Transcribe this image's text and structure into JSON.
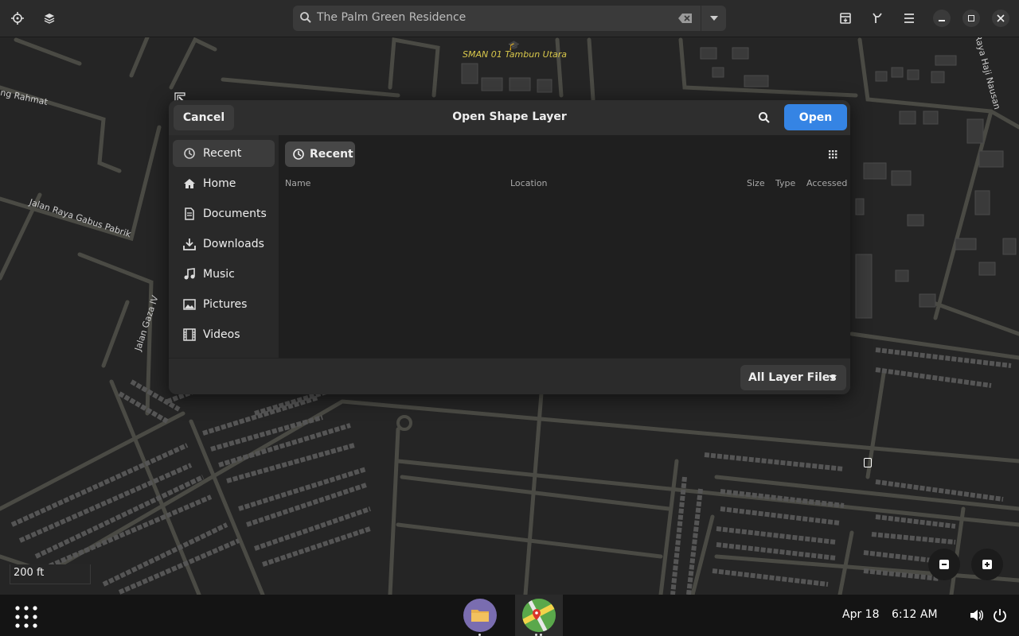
{
  "window": {
    "search_value": "The Palm Green Residence"
  },
  "map": {
    "labels": [
      "ng Rahmat",
      "Jalan Raya Gabus Pabrik",
      "Jalan Gaza IV",
      "Raya Haji Nausan"
    ],
    "poi": "SMAN 01 Tambun Utara",
    "scale": "200 ft"
  },
  "dialog": {
    "title": "Open Shape Layer",
    "cancel_label": "Cancel",
    "open_label": "Open",
    "sidebar": [
      {
        "label": "Recent",
        "icon": "clock-icon",
        "active": true
      },
      {
        "label": "Home",
        "icon": "home-icon"
      },
      {
        "label": "Documents",
        "icon": "document-icon"
      },
      {
        "label": "Downloads",
        "icon": "download-icon"
      },
      {
        "label": "Music",
        "icon": "music-icon"
      },
      {
        "label": "Pictures",
        "icon": "picture-icon"
      },
      {
        "label": "Videos",
        "icon": "video-icon"
      }
    ],
    "breadcrumb": "Recent",
    "columns": [
      "Name",
      "Location",
      "Size",
      "Type",
      "Accessed"
    ],
    "filter": "All Layer Files"
  },
  "taskbar": {
    "date": "Apr 18",
    "time": "6:12 AM"
  },
  "colors": {
    "accent": "#3584e4",
    "poi": "#d9c84b"
  }
}
